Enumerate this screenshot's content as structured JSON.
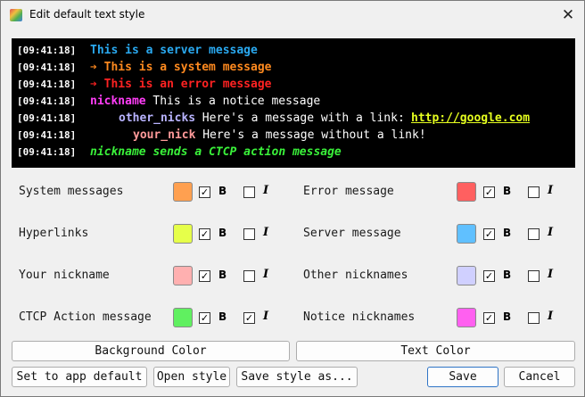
{
  "window": {
    "title": "Edit default text style"
  },
  "preview": {
    "lines": [
      {
        "ts": "[09:41:18]",
        "text": "This is a server message",
        "color": "#2aa9f0"
      },
      {
        "ts": "[09:41:18]",
        "text": "➔ This is a system message",
        "color": "#ff8a1f"
      },
      {
        "ts": "[09:41:18]",
        "text": "➔ This is an error message",
        "color": "#ff2222"
      },
      {
        "ts": "[09:41:18]",
        "nick": "nickname",
        "nick_color": "#ff3df7",
        "text": "This is a notice message",
        "color": "#ffffff"
      },
      {
        "ts": "[09:41:18]",
        "nick": "other_nicks",
        "nick_color": "#b8b3ff",
        "text": "Here's a message with a link:",
        "link": "http://google.com",
        "color": "#ffffff"
      },
      {
        "ts": "[09:41:18]",
        "nick": "your_nick",
        "nick_color": "#ff9a9a",
        "text": "Here's a message without a link!",
        "color": "#ffffff"
      },
      {
        "ts": "[09:41:18]",
        "text": "nickname sends a CTCP action message",
        "color": "#3af23a"
      }
    ]
  },
  "styles": {
    "left": [
      {
        "label": "System messages",
        "color": "#ffa050",
        "bold": true,
        "italic": false
      },
      {
        "label": "Hyperlinks",
        "color": "#e6ff4a",
        "bold": true,
        "italic": false
      },
      {
        "label": "Your nickname",
        "color": "#ffb0b0",
        "bold": true,
        "italic": false
      },
      {
        "label": "CTCP Action message",
        "color": "#60f060",
        "bold": true,
        "italic": true
      }
    ],
    "right": [
      {
        "label": "Error message",
        "color": "#ff6060",
        "bold": true,
        "italic": false
      },
      {
        "label": "Server message",
        "color": "#60c0ff",
        "bold": true,
        "italic": false
      },
      {
        "label": "Other nicknames",
        "color": "#d0d0ff",
        "bold": true,
        "italic": false
      },
      {
        "label": "Notice nicknames",
        "color": "#ff60f0",
        "bold": true,
        "italic": false
      }
    ],
    "bold_label": "B",
    "italic_label": "I"
  },
  "buttons": {
    "background_color": "Background Color",
    "text_color": "Text Color",
    "set_default": "Set to app default",
    "open_style": "Open style",
    "save_style_as": "Save style as...",
    "save": "Save",
    "cancel": "Cancel"
  }
}
